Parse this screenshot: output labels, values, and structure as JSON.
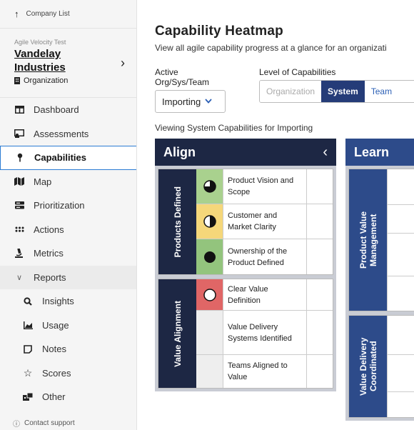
{
  "sidebar": {
    "company_list_label": "Company List",
    "org": {
      "subtitle": "Agile Velocity Test",
      "name": "Vandelay Industries",
      "type": "Organization"
    },
    "nav": [
      {
        "label": "Dashboard",
        "icon": "dashboard-icon"
      },
      {
        "label": "Assessments",
        "icon": "assessments-icon"
      },
      {
        "label": "Capabilities",
        "icon": "pin-icon",
        "active": true
      },
      {
        "label": "Map",
        "icon": "map-icon"
      },
      {
        "label": "Prioritization",
        "icon": "prioritization-icon"
      },
      {
        "label": "Actions",
        "icon": "actions-icon"
      },
      {
        "label": "Metrics",
        "icon": "microscope-icon"
      },
      {
        "label": "Reports",
        "icon": "chevron-down-icon",
        "expanded": true
      }
    ],
    "reports_sub": [
      {
        "label": "Insights",
        "icon": "search-icon"
      },
      {
        "label": "Usage",
        "icon": "chart-icon"
      },
      {
        "label": "Notes",
        "icon": "note-icon"
      },
      {
        "label": "Scores",
        "icon": "star-icon"
      },
      {
        "label": "Other",
        "icon": "other-icon"
      }
    ],
    "contact_label": "Contact support"
  },
  "main": {
    "title": "Capability Heatmap",
    "description": "View all agile capability progress at a glance for an organizati",
    "active_label": "Active Org/Sys/Team",
    "active_value": "Importing",
    "level_label": "Level of Capabilities",
    "levels": [
      "Organization",
      "System",
      "Team"
    ],
    "active_level": "System",
    "viewing": "Viewing System Capabilities for Importing"
  },
  "heatmap": {
    "align": {
      "title": "Align",
      "groups": [
        {
          "label": "Products Defined",
          "rows": [
            {
              "capability": "Product Vision and Scope",
              "color": "#a9d18e",
              "progress": 0.75
            },
            {
              "capability": "Customer and Market Clarity",
              "color": "#f5d77a",
              "progress": 0.5
            },
            {
              "capability": "Ownership of the Product Defined",
              "color": "#93c47d",
              "progress": 1.0
            }
          ]
        },
        {
          "label": "Value Alignment",
          "rows": [
            {
              "capability": "Clear Value Definition",
              "color": "#e06666",
              "progress": 0
            },
            {
              "capability": "Value Delivery Systems Identified",
              "color": "",
              "progress": null
            },
            {
              "capability": "Teams Aligned to Value",
              "color": "",
              "progress": null
            }
          ]
        }
      ]
    },
    "learn": {
      "title": "Learn",
      "groups": [
        {
          "label": "Product Value Management"
        },
        {
          "label": "Value Delivery Coordinated"
        }
      ]
    }
  }
}
